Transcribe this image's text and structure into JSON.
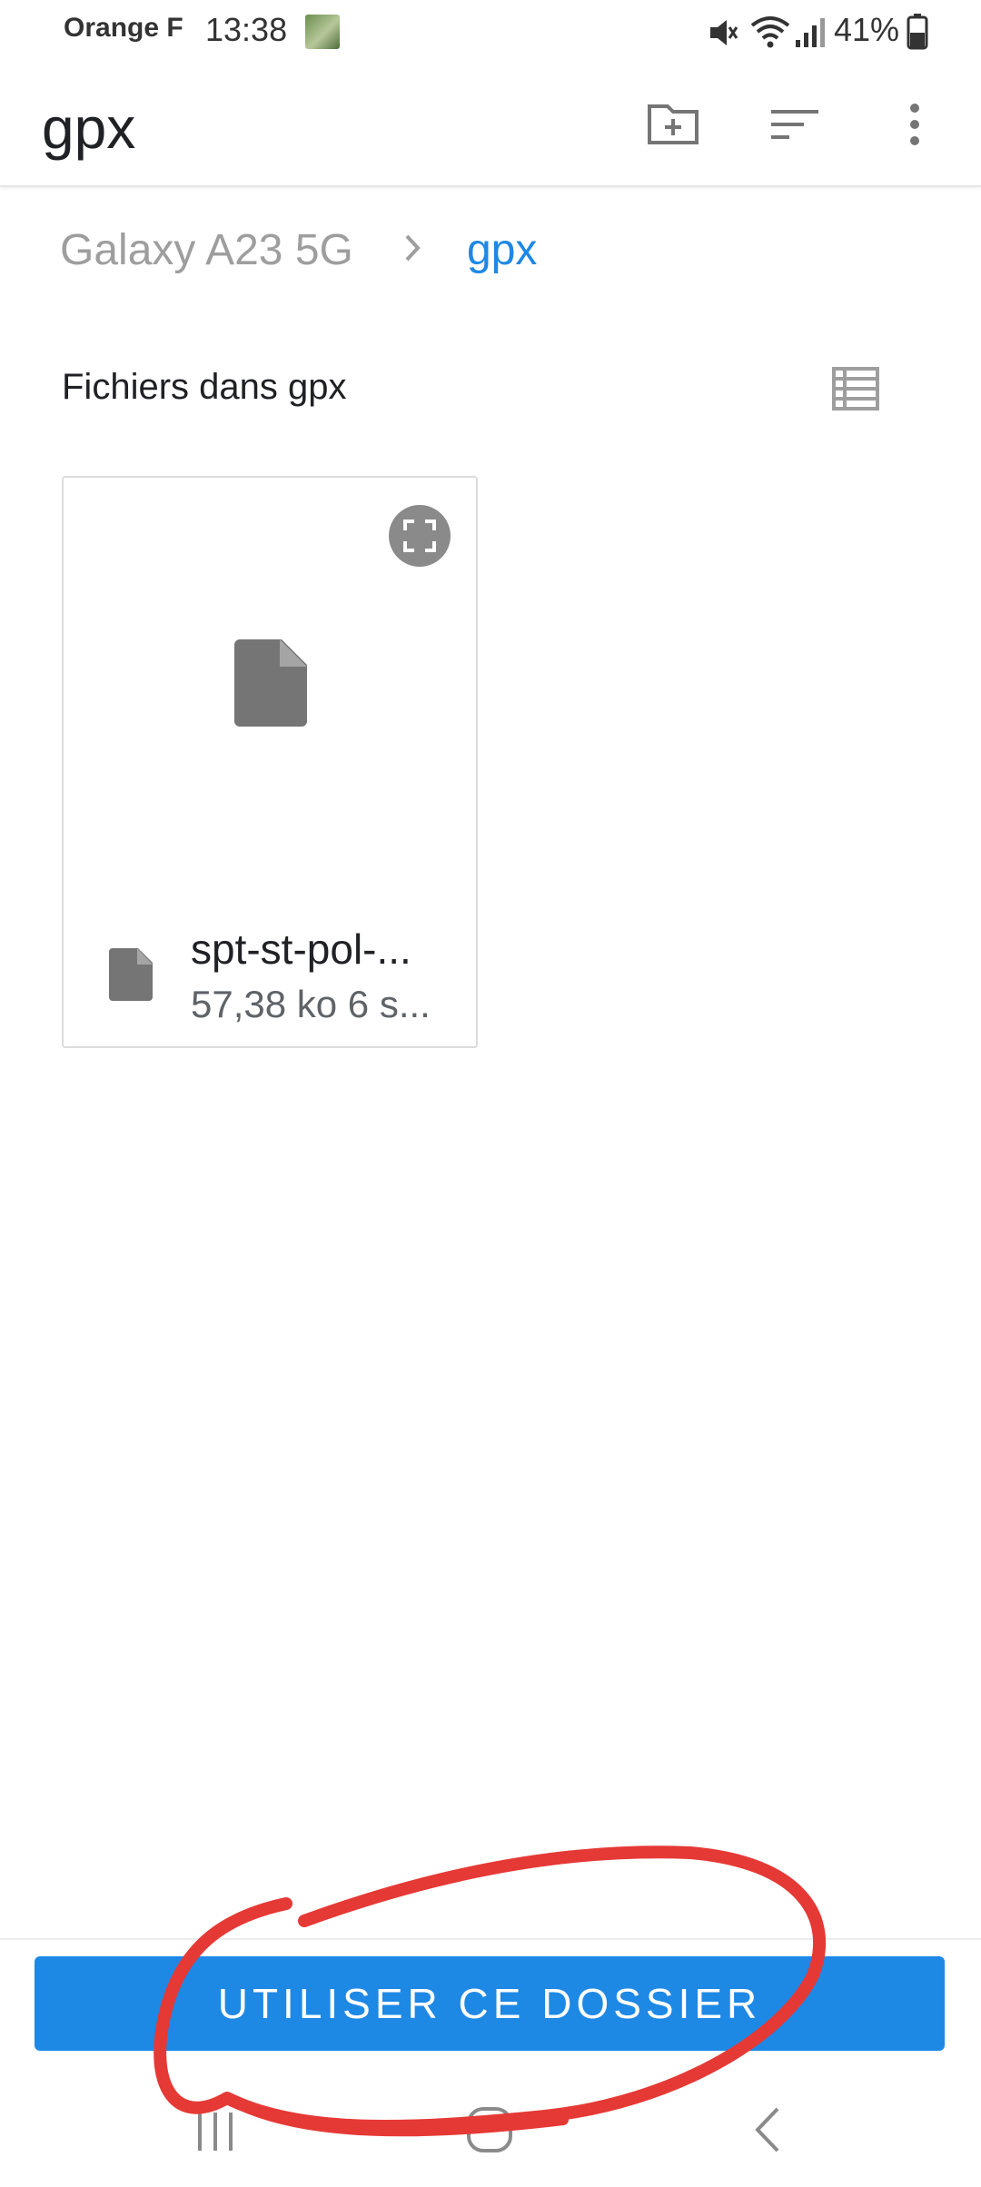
{
  "status_bar": {
    "carrier": "Orange F",
    "time": "13:38",
    "battery": "41%",
    "icons": [
      "photo-notification-icon",
      "mute-icon",
      "wifi-icon",
      "signal-icon",
      "battery-icon"
    ]
  },
  "app_bar": {
    "title": "gpx",
    "actions": [
      "new-folder-icon",
      "sort-icon",
      "more-vert-icon"
    ]
  },
  "breadcrumb": {
    "root": "Galaxy A23 5G",
    "current": "gpx"
  },
  "section": {
    "title": "Fichiers dans gpx",
    "view_toggle_icon": "list-view-icon"
  },
  "files": [
    {
      "name": "spt-st-pol-...",
      "meta": "57,38 ko 6 s...",
      "icon": "file-icon"
    }
  ],
  "primary_action": {
    "label": "UTILISER CE DOSSIER"
  },
  "colors": {
    "accent": "#1e88e5",
    "annotation": "#e53935",
    "icon_gray": "#757575"
  },
  "nav_bar": [
    "recents-icon",
    "home-icon",
    "back-icon"
  ]
}
